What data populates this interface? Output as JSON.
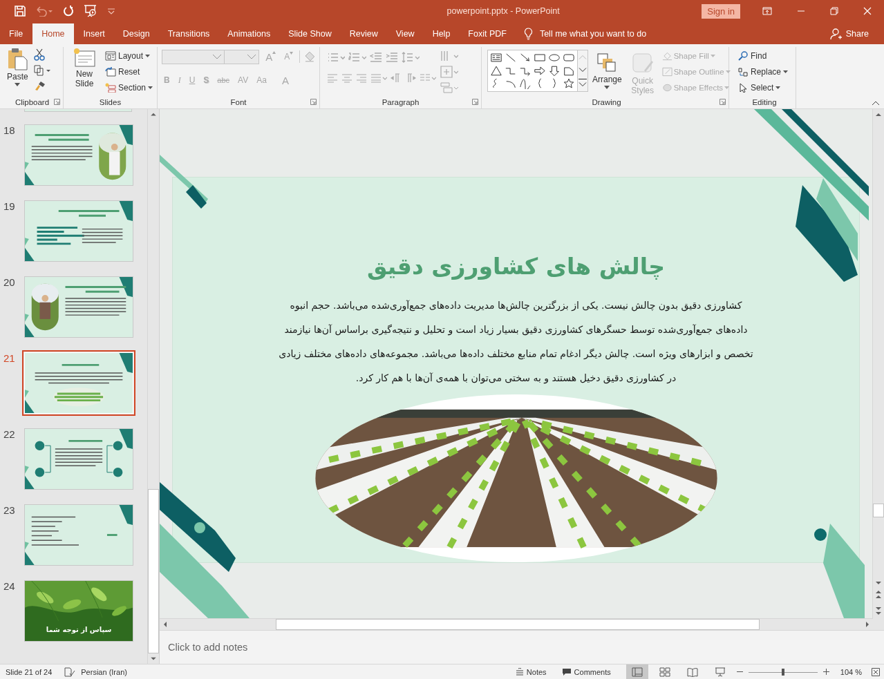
{
  "window": {
    "title": "powerpoint.pptx  -  PowerPoint",
    "sign_in": "Sign in"
  },
  "tabs": [
    {
      "label": "File",
      "selected": false
    },
    {
      "label": "Home",
      "selected": true
    },
    {
      "label": "Insert",
      "selected": false
    },
    {
      "label": "Design",
      "selected": false
    },
    {
      "label": "Transitions",
      "selected": false
    },
    {
      "label": "Animations",
      "selected": false
    },
    {
      "label": "Slide Show",
      "selected": false
    },
    {
      "label": "Review",
      "selected": false
    },
    {
      "label": "View",
      "selected": false
    },
    {
      "label": "Help",
      "selected": false
    },
    {
      "label": "Foxit PDF",
      "selected": false
    }
  ],
  "tell_me": "Tell me what you want to do",
  "share": "Share",
  "ribbon": {
    "clipboard": {
      "label": "Clipboard",
      "paste": "Paste"
    },
    "slides": {
      "label": "Slides",
      "new_slide": "New Slide",
      "commands": [
        {
          "kind": "layout",
          "label": "Layout",
          "dropdown": true
        },
        {
          "kind": "reset",
          "label": "Reset",
          "dropdown": false
        },
        {
          "kind": "section",
          "label": "Section",
          "dropdown": true
        }
      ]
    },
    "font": {
      "label": "Font",
      "disabled": true,
      "grow": "A",
      "shrink": "A",
      "styles": [
        {
          "kind": "bold",
          "text": "B"
        },
        {
          "kind": "italic",
          "text": "I"
        },
        {
          "kind": "underline",
          "text": "U"
        },
        {
          "kind": "shadow",
          "text": "S"
        },
        {
          "kind": "strike",
          "text": "abc"
        },
        {
          "kind": "spacing",
          "text": "AV"
        },
        {
          "kind": "case",
          "text": "Aa"
        },
        {
          "kind": "color",
          "text": "A"
        }
      ]
    },
    "paragraph": {
      "label": "Paragraph",
      "disabled": true
    },
    "drawing": {
      "label": "Drawing",
      "arrange": "Arrange",
      "quick_styles": {
        "label": "Quick Styles",
        "disabled": true
      },
      "shape_commands": [
        {
          "kind": "fill",
          "label": "Shape Fill",
          "disabled": true
        },
        {
          "kind": "outline",
          "label": "Shape Outline",
          "disabled": true
        },
        {
          "kind": "effects",
          "label": "Shape Effects",
          "disabled": true
        }
      ]
    },
    "editing": {
      "label": "Editing",
      "commands": [
        {
          "kind": "find",
          "label": "Find",
          "dropdown": false
        },
        {
          "kind": "replace",
          "label": "Replace",
          "dropdown": true
        },
        {
          "kind": "select",
          "label": "Select",
          "dropdown": true
        }
      ]
    }
  },
  "thumbnails": [
    {
      "number": "18",
      "kind": "photo-right",
      "selected": false
    },
    {
      "number": "19",
      "kind": "chart",
      "selected": false
    },
    {
      "number": "20",
      "kind": "photo-left",
      "selected": false
    },
    {
      "number": "21",
      "kind": "picture-bottom",
      "selected": true
    },
    {
      "number": "22",
      "kind": "icons",
      "selected": false
    },
    {
      "number": "23",
      "kind": "list",
      "selected": false
    },
    {
      "number": "24",
      "kind": "closing",
      "selected": false,
      "caption": "سپاس از توجه شما"
    }
  ],
  "slide": {
    "title": "چالش های کشاورزی دقیق",
    "body_lines": [
      "کشاورزی دقیق بدون چالش نیست. یکی از بزرگترین چالش‌ها مدیریت داده‌های جمع‌آوری‌شده می‌باشد. حجم انبوه",
      "داده‌های جمع‌آوری‌شده توسط حسگرهای کشاورزی دقیق بسیار زیاد است و تحلیل و نتیجه‌گیری براساس آن‌ها نیازمند",
      "تخصص و ابزارهای ویژه است. چالش دیگر ادغام تمام منابع مختلف داده‌ها می‌باشد. مجموعه‌های داده‌های مختلف زیادی",
      "در کشاورزی دقیق دخیل هستند و به سختی می‌توان با همه‌ی آن‌ها با هم کار کرد."
    ]
  },
  "notes": {
    "placeholder": "Click to add notes"
  },
  "status_bar": {
    "slide_counter": "Slide 21 of 24",
    "language": "Persian (Iran)",
    "notes": "Notes",
    "comments": "Comments",
    "views": [
      {
        "kind": "normal",
        "selected": true
      },
      {
        "kind": "sorter",
        "selected": false
      },
      {
        "kind": "reading",
        "selected": false
      },
      {
        "kind": "slideshow",
        "selected": false
      }
    ],
    "zoom": {
      "level": 0.5,
      "reading": "104 %"
    }
  }
}
